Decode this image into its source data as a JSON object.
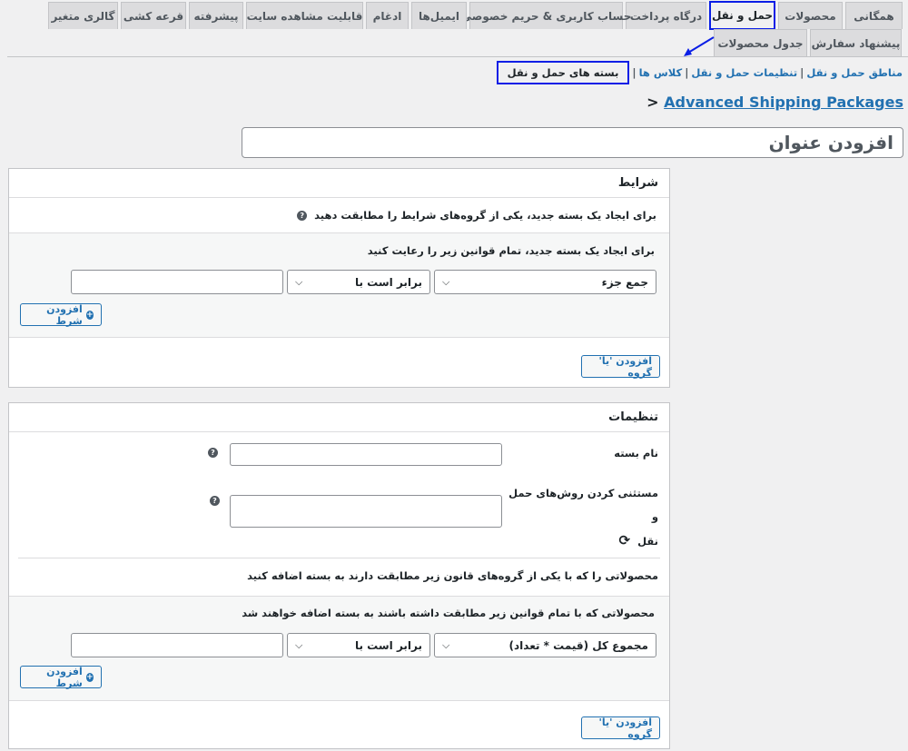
{
  "tabs": [
    {
      "label": "همگانی",
      "active": false
    },
    {
      "label": "محصولات",
      "active": false
    },
    {
      "label": "حمل و نقل",
      "active": true
    },
    {
      "label": "درگاه پرداخت",
      "active": false
    },
    {
      "label": "حساب کاربری & حریم خصوصی",
      "active": false
    },
    {
      "label": "ایمیل‌ها",
      "active": false
    },
    {
      "label": "ادغام",
      "active": false
    },
    {
      "label": "قابلیت مشاهده سایت",
      "active": false
    },
    {
      "label": "پیشرفته",
      "active": false
    },
    {
      "label": "قرعه کشی",
      "active": false
    },
    {
      "label": "گالری متغیر",
      "active": false
    },
    {
      "label": "پیشنهاد سفارش",
      "active": false
    },
    {
      "label": "جدول محصولات",
      "active": false
    }
  ],
  "subnav": {
    "zones": "مناطق حمل و نقل",
    "settings": "تنظیمات حمل و نقل",
    "classes": "کلاس ها",
    "packages": "بسته های حمل و نقل",
    "sep": "|"
  },
  "breadcrumb": {
    "link": "Advanced Shipping Packages",
    "marker": ">"
  },
  "title_placeholder": "افزودن عنوان",
  "conditions": {
    "heading": "شرایط",
    "intro": "برای ایجاد یک بسته جدید، یکی از گروه‌های شرایط را مطابقت دهید",
    "rule_intro": "برای ایجاد یک بسته جدید، تمام قوانین زیر را رعایت کنید",
    "field_select": "جمع جزء",
    "operator_select": "برابر است با",
    "add_condition": "افزودن شرط",
    "add_or_group": "افزودن 'یا' گروه"
  },
  "settings": {
    "heading": "تنظیمات",
    "package_name_label": "نام بسته",
    "exclude_label_line1": "مستثنی کردن روش‌های حمل و",
    "exclude_label_line2": "نقل",
    "products_intro": "محصولاتی را که با یکی از گروه‌های قانون زیر مطابقت دارند به بسته اضافه کنید",
    "products_rule_intro": "محصولاتی که با تمام قوانین زیر مطابقت داشته باشند به بسته اضافه خواهند شد",
    "field_select": "مجموع کل (قیمت * تعداد)",
    "operator_select": "برابر است با",
    "add_condition": "افزودن شرط",
    "add_or_group": "افزودن 'یا' گروه"
  },
  "icons": {
    "help": "?",
    "plus": "+",
    "chevron": "⌵",
    "refresh": "⟳"
  },
  "colors": {
    "highlight": "#0a1ee6",
    "link": "#2271b1"
  }
}
